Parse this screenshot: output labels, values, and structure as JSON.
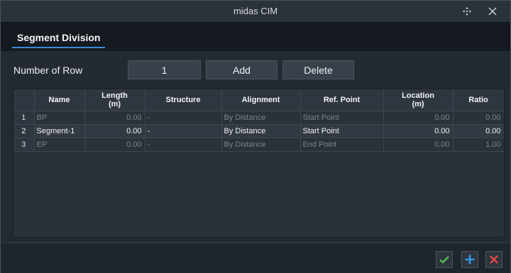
{
  "window": {
    "title": "midas CIM"
  },
  "tabs": [
    {
      "label": "Segment Division"
    }
  ],
  "controls": {
    "number_of_row_label": "Number of Row",
    "number_of_row_value": "1",
    "add_label": "Add",
    "delete_label": "Delete"
  },
  "table": {
    "headers": {
      "name": "Name",
      "length": "Length",
      "length_unit": "(m)",
      "structure": "Structure",
      "alignment": "Alignment",
      "ref_point": "Ref. Point",
      "location": "Location",
      "location_unit": "(m)",
      "ratio": "Ratio"
    },
    "rows": [
      {
        "index": "1",
        "name": "BP",
        "length": "0.00",
        "structure": "-",
        "alignment": "By Distance",
        "ref_point": "Start Point",
        "location": "0.00",
        "ratio": "0.00"
      },
      {
        "index": "2",
        "name": "Segment-1",
        "length": "0.00",
        "structure": "-",
        "alignment": "By Distance",
        "ref_point": "Start Point",
        "location": "0.00",
        "ratio": "0.00"
      },
      {
        "index": "3",
        "name": "EP",
        "length": "0.00",
        "structure": "-",
        "alignment": "By Distance",
        "ref_point": "End Point",
        "location": "0.00",
        "ratio": "1.00"
      }
    ]
  },
  "colors": {
    "accent": "#3a8bd6",
    "ok": "#4fbf4f",
    "add": "#2f9be3",
    "cancel": "#e04848"
  },
  "icons": {
    "move": "move-icon",
    "close": "close-icon",
    "ok": "check-icon",
    "add": "plus-icon",
    "cancel": "x-icon"
  }
}
